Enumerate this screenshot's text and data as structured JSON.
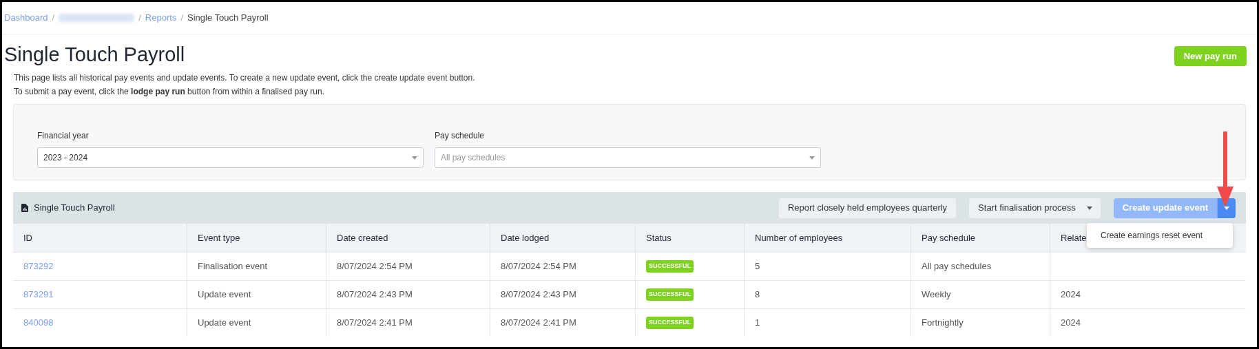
{
  "breadcrumb_separator": "/",
  "breadcrumb": [
    {
      "label": "Dashboard",
      "kind": "link"
    },
    {
      "kind": "redacted"
    },
    {
      "label": "Reports",
      "kind": "link"
    },
    {
      "label": "Single Touch Payroll",
      "kind": "current"
    }
  ],
  "title": "Single Touch Payroll",
  "new_button": "New pay run",
  "description": [
    "This page lists all historical pay events and update events. To create a new update event, click the create update event button.",
    "To submit a pay event, click the **lodge pay run** button from within a finalised pay run."
  ],
  "filters": [
    {
      "label": "Financial year",
      "value": "2023 - 2024"
    },
    {
      "label": "Pay schedule",
      "placeholder": "All pay schedules"
    }
  ],
  "panel": {
    "title": "Single Touch Payroll",
    "buttons": [
      {
        "label": "Report closely held employees quarterly",
        "kind": "plain"
      },
      {
        "label": "Start finalisation process",
        "kind": "dropdown"
      },
      {
        "label": "Create update event",
        "kind": "split"
      }
    ],
    "menu": [
      "Create earnings reset event"
    ]
  },
  "table": {
    "columns": [
      "ID",
      "Event type",
      "Date created",
      "Date lodged",
      "Status",
      "Number of employees",
      "Pay schedule",
      "Relate"
    ],
    "rows": [
      {
        "id": "873292",
        "event_type": "Finalisation event",
        "date_created": "8/07/2024 2:54 PM",
        "date_lodged": "8/07/2024 2:54 PM",
        "status": "SUCCESSFUL",
        "employees": "5",
        "pay_schedule": "All pay schedules",
        "related": ""
      },
      {
        "id": "873291",
        "event_type": "Update event",
        "date_created": "8/07/2024 2:43 PM",
        "date_lodged": "8/07/2024 2:43 PM",
        "status": "SUCCESSFUL",
        "employees": "8",
        "pay_schedule": "Weekly",
        "related": "2024"
      },
      {
        "id": "840098",
        "event_type": "Update event",
        "date_created": "8/07/2024 2:41 PM",
        "date_lodged": "8/07/2024 2:41 PM",
        "status": "SUCCESSFUL",
        "employees": "1",
        "pay_schedule": "Fortnightly",
        "related": "2024"
      }
    ]
  }
}
